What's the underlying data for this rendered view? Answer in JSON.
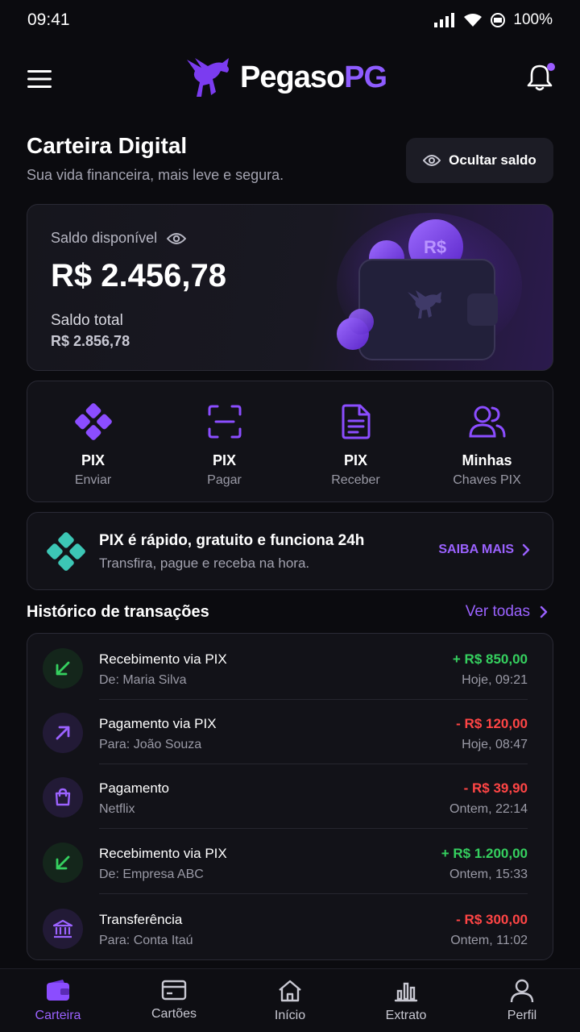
{
  "status": {
    "time": "09:41",
    "battery": "100%"
  },
  "header": {
    "logo_main": "Pegaso",
    "logo_accent": "PG"
  },
  "page": {
    "title": "Carteira Digital",
    "subtitle": "Sua vida financeira, mais leve e segura.",
    "hide_balance_label": "Ocultar saldo"
  },
  "balance": {
    "available_label": "Saldo disponível",
    "available_value": "R$ 2.456,78",
    "total_label": "Saldo total",
    "total_value": "R$ 2.856,78"
  },
  "quick_actions": [
    {
      "title": "PIX",
      "sub": "Enviar",
      "icon": "pix-icon"
    },
    {
      "title": "PIX",
      "sub": "Pagar",
      "icon": "scan-icon"
    },
    {
      "title": "PIX",
      "sub": "Receber",
      "icon": "document-icon"
    },
    {
      "title": "Minhas",
      "sub": "Chaves PIX",
      "icon": "users-icon"
    }
  ],
  "pix_banner": {
    "title": "PIX é rápido, gratuito e funciona 24h",
    "subtitle": "Transfira, pague e receba na hora.",
    "cta": "SAIBA MAIS"
  },
  "history": {
    "title": "Histórico de transações",
    "see_all": "Ver todas",
    "items": [
      {
        "title": "Recebimento via PIX",
        "sub": "De: Maria Silva",
        "amount": "+ R$ 850,00",
        "date": "Hoje, 09:21",
        "type": "in"
      },
      {
        "title": "Pagamento via PIX",
        "sub": "Para: João Souza",
        "amount": "- R$ 120,00",
        "date": "Hoje, 08:47",
        "type": "out"
      },
      {
        "title": "Pagamento",
        "sub": "Netflix",
        "amount": "- R$ 39,90",
        "date": "Ontem, 22:14",
        "type": "bag"
      },
      {
        "title": "Recebimento via PIX",
        "sub": "De: Empresa ABC",
        "amount": "+ R$ 1.200,00",
        "date": "Ontem, 15:33",
        "type": "in"
      },
      {
        "title": "Transferência",
        "sub": "Para: Conta Itaú",
        "amount": "- R$ 300,00",
        "date": "Ontem, 11:02",
        "type": "bank"
      }
    ]
  },
  "nav": [
    {
      "label": "Carteira",
      "icon": "wallet-icon",
      "active": true
    },
    {
      "label": "Cartões",
      "icon": "card-icon",
      "active": false
    },
    {
      "label": "Início",
      "icon": "home-icon",
      "active": false
    },
    {
      "label": "Extrato",
      "icon": "chart-icon",
      "active": false
    },
    {
      "label": "Perfil",
      "icon": "user-icon",
      "active": false
    }
  ],
  "colors": {
    "accent": "#9b62ff",
    "positive": "#35d05f",
    "negative": "#ff4545",
    "pix_teal": "#3cc6b5"
  }
}
